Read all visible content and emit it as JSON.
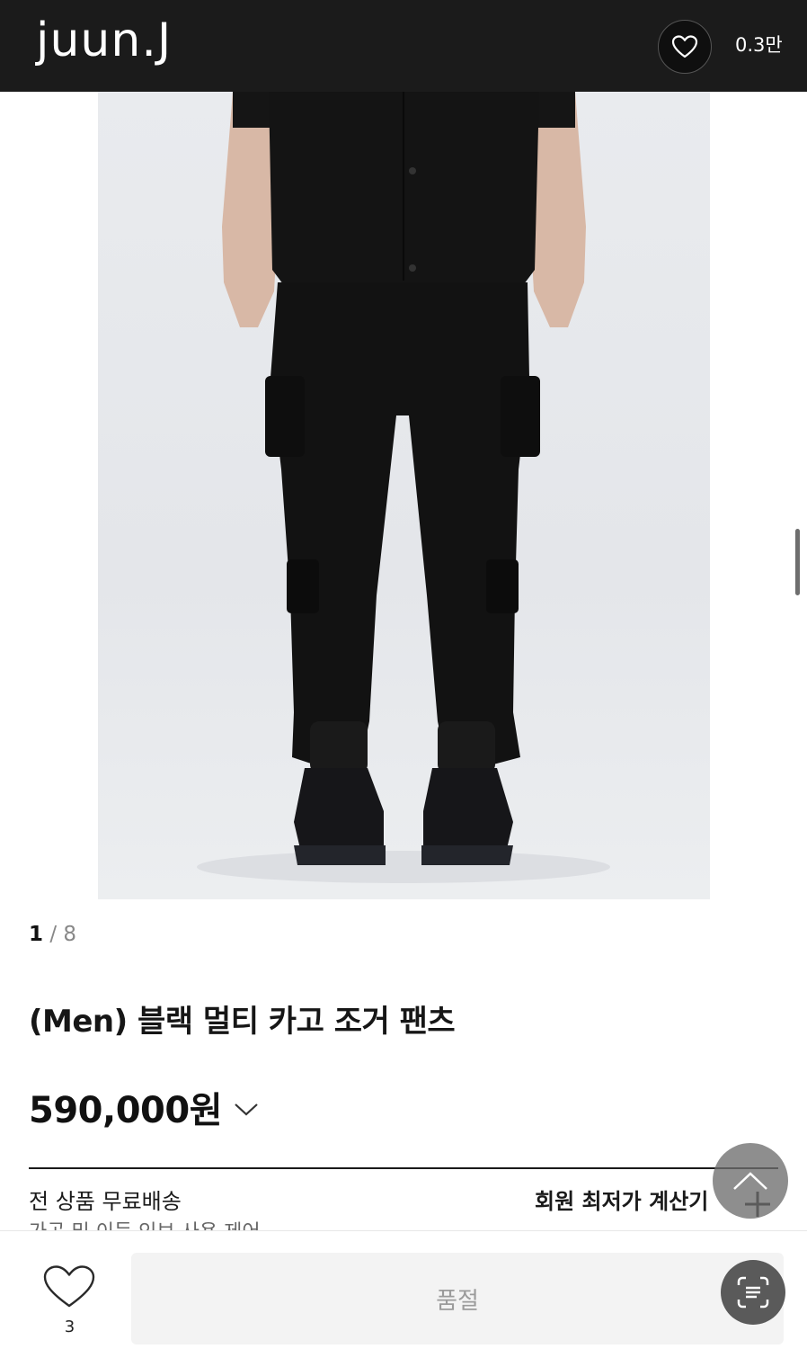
{
  "header": {
    "logo": "juun.J",
    "wish_count": "0.3만"
  },
  "product": {
    "image_alt": "product-photo",
    "pager_current": "1",
    "pager_sep": " / ",
    "pager_total": "8",
    "title": "(Men) 블랙 멀티 카고 조거 팬츠",
    "price": "590,000원",
    "shipping": "전 상품 무료배송",
    "member_calc": "회원 최저가 계산기",
    "cutoff_text": "가공 및 이득 인보 사용 제어"
  },
  "bottom_bar": {
    "like_count": "3",
    "soldout_label": "품절"
  },
  "colors": {
    "header_bg": "#1b1b1b",
    "soldout_bg": "#f3f3f3",
    "soldout_text": "#9b9b9b"
  }
}
